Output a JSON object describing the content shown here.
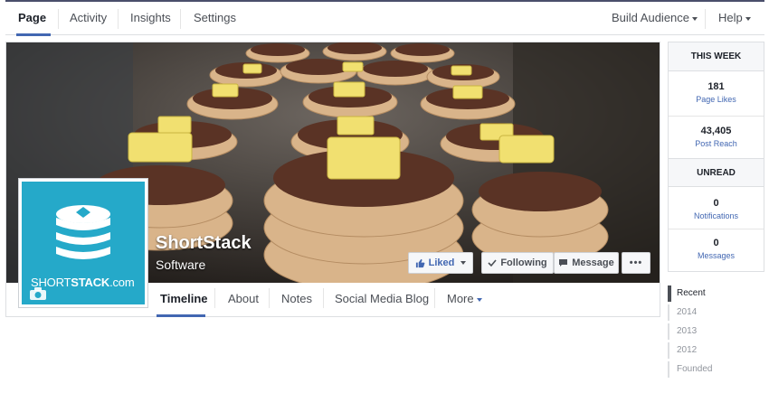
{
  "topbar": {
    "items": [
      {
        "label": "Page"
      },
      {
        "label": "Activity"
      },
      {
        "label": "Insights"
      },
      {
        "label": "Settings"
      }
    ],
    "build_audience": "Build Audience",
    "help": "Help"
  },
  "page": {
    "name": "ShortStack",
    "category": "Software",
    "logo_text_light": "SHORT",
    "logo_text_bold": "STACK",
    "logo_text_suffix": ".com"
  },
  "actions": {
    "liked": "Liked",
    "following": "Following",
    "message": "Message",
    "more": "•••"
  },
  "tabs": [
    {
      "label": "Timeline"
    },
    {
      "label": "About"
    },
    {
      "label": "Notes"
    },
    {
      "label": "Social Media Blog"
    },
    {
      "label": "More"
    }
  ],
  "stats": {
    "this_week": "THIS WEEK",
    "page_likes_value": "181",
    "page_likes_label": "Page Likes",
    "post_reach_value": "43,405",
    "post_reach_label": "Post Reach",
    "unread": "UNREAD",
    "notifications_value": "0",
    "notifications_label": "Notifications",
    "messages_value": "0",
    "messages_label": "Messages"
  },
  "years": [
    "Recent",
    "2014",
    "2013",
    "2012",
    "Founded"
  ],
  "colors": {
    "accent": "#4267b2",
    "brand_teal": "#25a9c9",
    "butter": "#f1e070",
    "chocolate": "#5a3325",
    "pancake": "#d9b48a"
  }
}
